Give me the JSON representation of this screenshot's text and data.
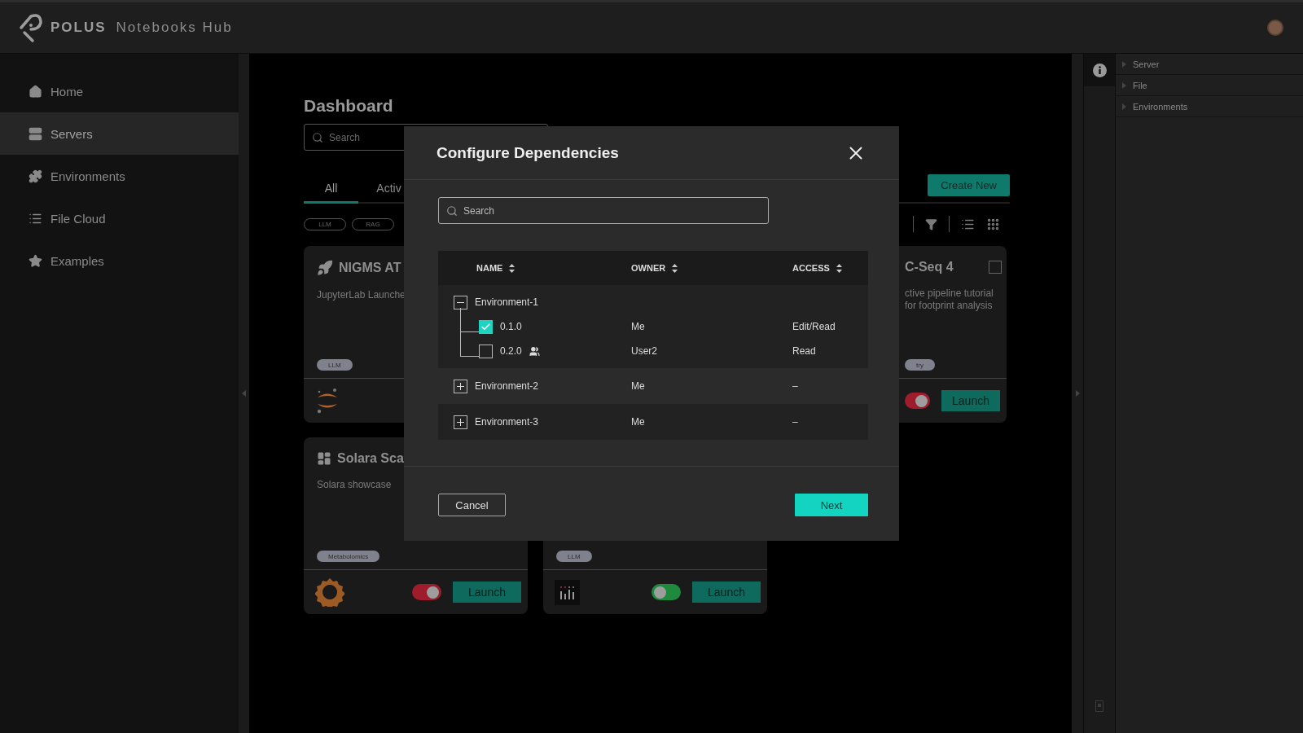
{
  "header": {
    "brand": "POLUS",
    "product": "Notebooks Hub"
  },
  "sidebar": {
    "items": [
      {
        "label": "Home",
        "selected": false
      },
      {
        "label": "Servers",
        "selected": true
      },
      {
        "label": "Environments",
        "selected": false
      },
      {
        "label": "File Cloud",
        "selected": false
      },
      {
        "label": "Examples",
        "selected": false
      }
    ]
  },
  "dashboard": {
    "title": "Dashboard",
    "search": {
      "placeholder": "Search"
    },
    "tabs": [
      {
        "label": "All",
        "selected": true
      },
      {
        "label": "Activ",
        "selected": false
      }
    ],
    "create_button": "Create New",
    "filters": [
      "LLM",
      "RAG"
    ],
    "cards": [
      {
        "title": "NIGMS AT",
        "description": "JupyterLab Launche",
        "tag": "LLM"
      },
      {
        "title": "C-Seq 4",
        "description": "ctive pipeline tutorial for footprint analysis",
        "tag": "try",
        "toggle_on": true,
        "launch": "Launch",
        "checked": false
      },
      {
        "title": "Solara Sca",
        "description": "Solara showcase",
        "tag": "Metabolomics",
        "toggle_on": true,
        "launch": "Launch"
      },
      {
        "tag": "LLM",
        "toggle_on": false,
        "launch": "Launch"
      }
    ]
  },
  "right_panel": {
    "sections": [
      {
        "label": "Server",
        "expanded": false
      },
      {
        "label": "File",
        "expanded": false
      },
      {
        "label": "Environments",
        "expanded": false
      }
    ]
  },
  "modal": {
    "title": "Configure Dependencies",
    "search": {
      "placeholder": "Search"
    },
    "columns": [
      "NAME",
      "OWNER",
      "ACCESS"
    ],
    "rows": [
      {
        "name": "Environment-1",
        "expanded": true,
        "children": [
          {
            "name": "0.1.0",
            "checked": true,
            "shared": false,
            "owner": "Me",
            "access": "Edit/Read"
          },
          {
            "name": "0.2.0",
            "checked": false,
            "shared": true,
            "owner": "User2",
            "access": "Read"
          }
        ]
      },
      {
        "name": "Environment-2",
        "expanded": false,
        "owner": "Me",
        "access": "–"
      },
      {
        "name": "Environment-3",
        "expanded": false,
        "owner": "Me",
        "access": "–"
      }
    ],
    "cancel": "Cancel",
    "next": "Next"
  }
}
